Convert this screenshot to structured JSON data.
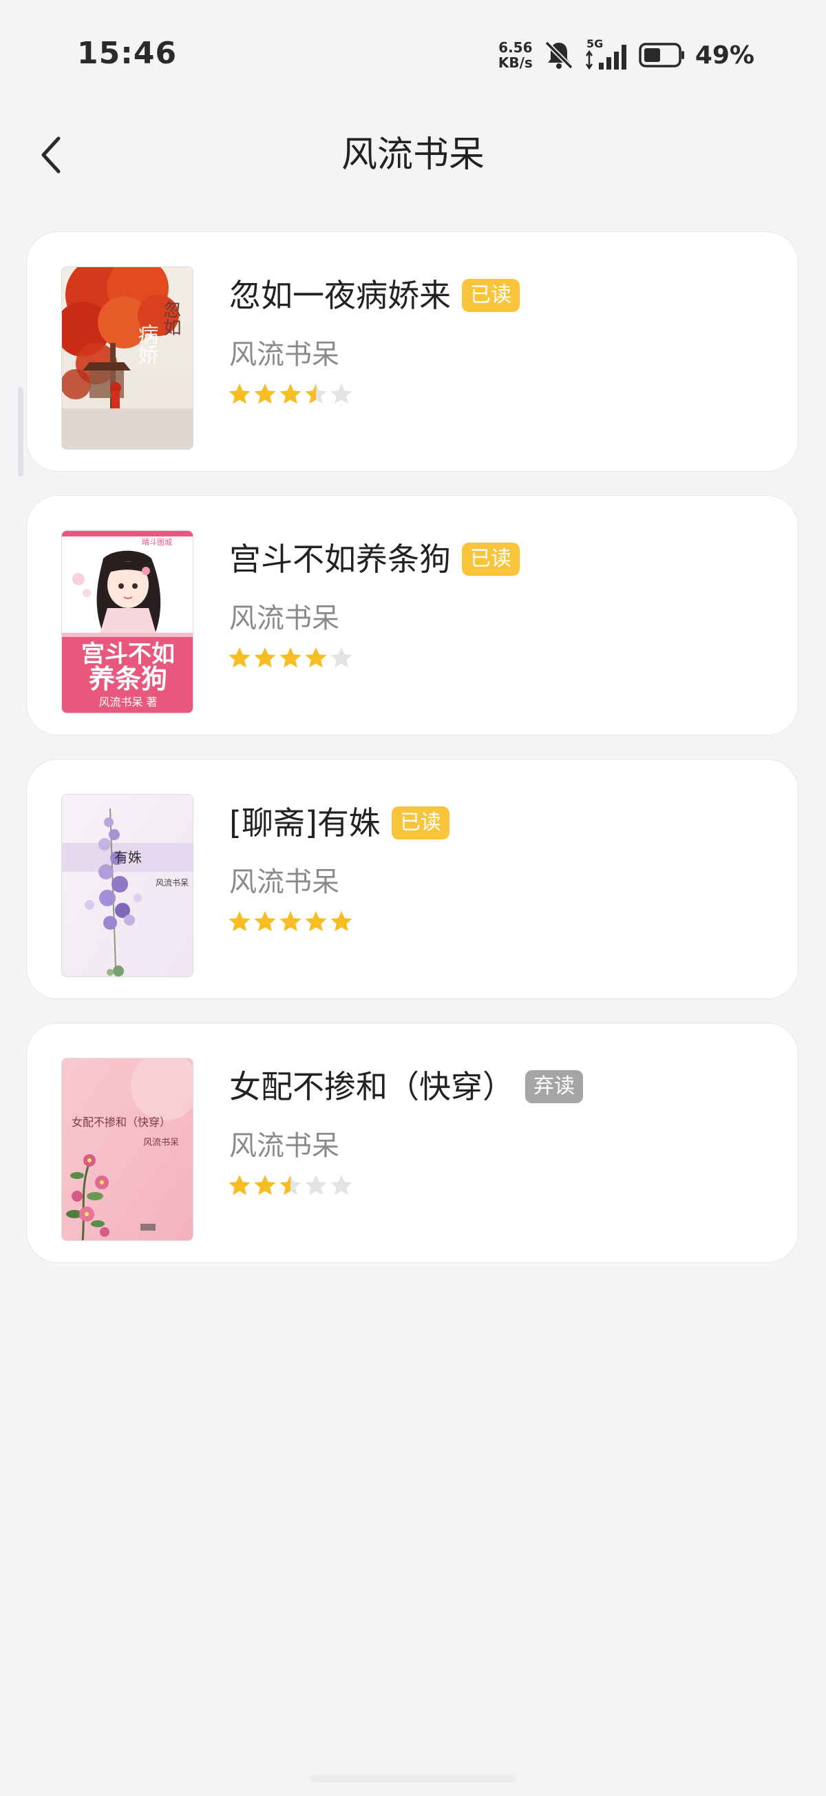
{
  "status_bar": {
    "time": "15:46",
    "net_speed_value": "6.56",
    "net_speed_unit": "KB/s",
    "network": "5G",
    "battery_percent": "49%",
    "battery_level": 0.49,
    "icons": [
      "mute-bell-icon",
      "signal-icon",
      "battery-icon"
    ]
  },
  "header": {
    "back_icon": "back-chevron-icon",
    "title": "风流书呆"
  },
  "colors": {
    "badge_read": "#f8c43a",
    "badge_dropped": "#a5a5a5",
    "star_filled": "#f8bd22",
    "star_empty": "#e3e3e3",
    "background": "#f3f4f6",
    "card": "#ffffff"
  },
  "books": [
    {
      "title": "忽如一夜病娇来",
      "status": "已读",
      "status_type": "read",
      "author": "风流书呆",
      "rating": 3.5,
      "max_rating": 5,
      "cover": {
        "theme": "red-autumn-tree",
        "text": "忽如一夜病娇来"
      }
    },
    {
      "title": "宫斗不如养条狗",
      "status": "已读",
      "status_type": "read",
      "author": "风流书呆",
      "rating": 4,
      "max_rating": 5,
      "cover": {
        "theme": "pink-girl",
        "top_text": "晴斗图城",
        "main_text_1": "宫斗不如",
        "main_text_2": "养条狗",
        "author_text": "风流书呆 著"
      }
    },
    {
      "title": "[聊斋]有姝",
      "status": "已读",
      "status_type": "read",
      "author": "风流书呆",
      "rating": 5,
      "max_rating": 5,
      "cover": {
        "theme": "purple-flowers",
        "title_text": "有姝",
        "author_text": "风流书呆"
      }
    },
    {
      "title": "女配不掺和（快穿）",
      "status": "弃读",
      "status_type": "dropped",
      "author": "风流书呆",
      "rating": 2.5,
      "max_rating": 5,
      "cover": {
        "theme": "pink-blossom",
        "title_text": "女配不掺和（快穿）",
        "author_text": "风流书呆"
      }
    }
  ]
}
